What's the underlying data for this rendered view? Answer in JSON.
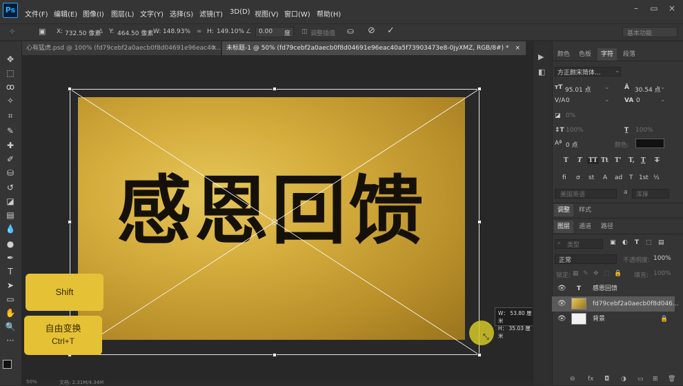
{
  "app": {
    "logo": "Ps"
  },
  "menu": [
    "文件(F)",
    "编辑(E)",
    "图像(I)",
    "图层(L)",
    "文字(Y)",
    "选择(S)",
    "滤镜(T)",
    "3D(D)",
    "视图(V)",
    "窗口(W)",
    "帮助(H)"
  ],
  "window_controls": [
    "minimize-icon",
    "restore-icon",
    "close-icon"
  ],
  "options": {
    "x_label": "X:",
    "x_value": "732.50 像素",
    "y_label": "Y:",
    "y_value": "464.50 像素",
    "w_label": "W:",
    "w_value": "148.93%",
    "h_label": "H:",
    "h_value": "149.10%",
    "angle_value": "0.00",
    "angle_unit": "度",
    "interp_label": "调整插值",
    "workspace": "基本功能"
  },
  "tabs": [
    {
      "label": "心有猛虎.psd @ 100% (fd79cebf2a0aecb0f8d04691e96eac40...",
      "close": "×"
    },
    {
      "label": "未标题-1 @ 50% (fd79cebf2a0aecb0f8d04691e96eac40a5f73903473e8-0jyXMZ, RGB/8#) *",
      "close": "×"
    }
  ],
  "canvas": {
    "headline": "感恩回馈",
    "gold_color": "#d4ac3c",
    "text_color": "#151108"
  },
  "dimension_tooltip": {
    "w": "W：  53.80 厘米",
    "h": "H：  35.03 厘米"
  },
  "keys": [
    {
      "line1": "Shift",
      "line2": ""
    },
    {
      "line1": "自由变换",
      "line2": "Ctrl+T"
    }
  ],
  "char_panel": {
    "tabs": [
      "颜色",
      "色板",
      "字符",
      "段落"
    ],
    "active_tab": "字符",
    "font": "方正颜宋简体...",
    "size": "95.01 点",
    "leading": "30.54 点",
    "kerning_label": "V/A",
    "kerning": "0",
    "tracking": "0",
    "percent_dim": "0%",
    "vscale": "100%",
    "hscale": "100%",
    "baseline": "0 点",
    "color_label": "颜色:",
    "language": "美国英语",
    "aa": "a",
    "aa_mode": "浑厚",
    "style_buttons": [
      "T",
      "T",
      "TT",
      "Tt",
      "T'",
      "T,",
      "T",
      "T"
    ],
    "opentype_buttons": [
      "fi",
      "σ",
      "st",
      "A",
      "ad",
      "T",
      "1st",
      "½"
    ]
  },
  "adjust_tabs": [
    "调整",
    "样式"
  ],
  "layers_panel": {
    "tabs": [
      "图层",
      "通道",
      "路径"
    ],
    "filter": "类型",
    "blend": "正常",
    "opacity_label": "不透明度:",
    "opacity": "100%",
    "lock_label": "锁定:",
    "fill_label": "填充:",
    "fill": "100%",
    "layers": [
      {
        "name": "感恩回馈",
        "kind": "text"
      },
      {
        "name": "fd79cebf2a0aecb0f8d046...",
        "kind": "image"
      },
      {
        "name": "背景",
        "kind": "background"
      }
    ]
  },
  "status": {
    "zoom": "50%",
    "doc": "文档: 2.31M/4.34M"
  }
}
